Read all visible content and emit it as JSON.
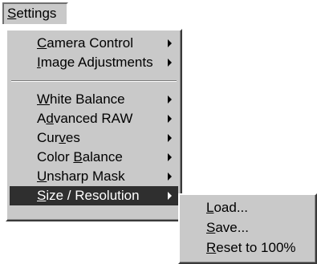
{
  "menubar": {
    "settings": {
      "pre": "",
      "key": "S",
      "post": "ettings"
    }
  },
  "main_menu": {
    "items": [
      {
        "pre": "",
        "key": "C",
        "post": "amera Control"
      },
      {
        "pre": "",
        "key": "I",
        "post": "mage Adjustments"
      },
      {
        "pre": "",
        "key": "W",
        "post": "hite Balance"
      },
      {
        "pre": "A",
        "key": "d",
        "post": "vanced RAW"
      },
      {
        "pre": "Cur",
        "key": "v",
        "post": "es"
      },
      {
        "pre": "Color ",
        "key": "B",
        "post": "alance"
      },
      {
        "pre": "",
        "key": "U",
        "post": "nsharp Mask"
      },
      {
        "pre": "",
        "key": "S",
        "post": "ize / Resolution"
      }
    ]
  },
  "sub_menu": {
    "items": [
      {
        "pre": "",
        "key": "L",
        "post": "oad..."
      },
      {
        "pre": "",
        "key": "S",
        "post": "ave..."
      },
      {
        "pre": "",
        "key": "R",
        "post": "eset to 100%"
      }
    ]
  },
  "colors": {
    "menu_background": "#c9c9c9",
    "highlight_background": "#2f2f2f",
    "highlight_text": "#ffffff"
  },
  "icons": {
    "submenu_arrow": "chevron-right-icon"
  }
}
